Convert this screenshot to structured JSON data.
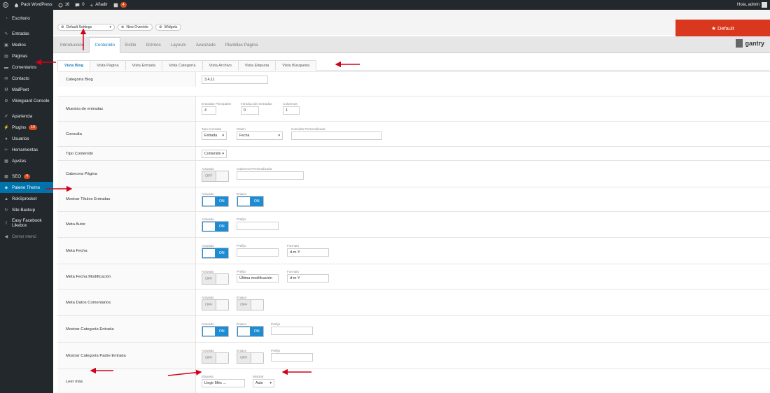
{
  "adminbar": {
    "site": "Pack WordPress",
    "updates": "16",
    "comments": "0",
    "new": "Añadir",
    "wf_badge": "4",
    "greeting": "Hola, admin"
  },
  "sidebar": [
    {
      "icon": "dashboard-icon",
      "label": "Escritorio"
    },
    {
      "icon": "pin-icon",
      "label": "Entradas",
      "sep": true
    },
    {
      "icon": "media-icon",
      "label": "Medios"
    },
    {
      "icon": "pages-icon",
      "label": "Páginas"
    },
    {
      "icon": "comments-icon",
      "label": "Comentarios"
    },
    {
      "icon": "mail-icon",
      "label": "Contacto"
    },
    {
      "icon": "mailpoet-icon",
      "label": "MailPoet"
    },
    {
      "icon": "gear-icon",
      "label": "Vikinguard Console"
    },
    {
      "icon": "brush-icon",
      "label": "Apariencia",
      "sep": true
    },
    {
      "icon": "plug-icon",
      "label": "Plugins",
      "badge": "10"
    },
    {
      "icon": "user-icon",
      "label": "Usuarios"
    },
    {
      "icon": "wrench-icon",
      "label": "Herramientas"
    },
    {
      "icon": "settings-icon",
      "label": "Ajustes"
    },
    {
      "icon": "seo-icon",
      "label": "SEO",
      "badge": "4",
      "sep": true
    },
    {
      "icon": "theme-icon",
      "label": "Palene Theme",
      "current": true
    },
    {
      "icon": "rocket-icon",
      "label": "RokSprocket"
    },
    {
      "icon": "backup-icon",
      "label": "Site Backup"
    },
    {
      "icon": "facebook-icon",
      "label": "Easy Facebook Likebox",
      "tall": true
    },
    {
      "icon": "collapse-icon",
      "label": "Cerrar menú",
      "collapse": true
    }
  ],
  "toolbar": {
    "preset": "Default Settings",
    "new_override": "New Override",
    "widgets": "Widgets",
    "default_btn": "★ Default"
  },
  "tabs": [
    "Introducción",
    "Contenido",
    "Estilo",
    "Gizmos",
    "Layouts",
    "Avanzado",
    "Plantillas Página"
  ],
  "brand": "gantry",
  "subtabs": [
    "Vista Blog",
    "Vista Página",
    "Vista Entrada",
    "Vista Categoría",
    "Vista Archivo",
    "Vista Etiqueta",
    "Vista Búsqueda"
  ],
  "rows": [
    {
      "label": "Categoría Blog",
      "fields": [
        {
          "kind": "input",
          "value": "3,4,11"
        }
      ]
    },
    {
      "label": "Muestra de entradas",
      "fields": [
        {
          "kind": "input",
          "cap": "Entradas Principales",
          "value": "4"
        },
        {
          "kind": "input",
          "cap": "Introducción Entradas",
          "value": "0"
        },
        {
          "kind": "input",
          "cap": "Columnas",
          "value": "1"
        }
      ]
    },
    {
      "label": "Consulta",
      "fields": [
        {
          "kind": "select",
          "cap": "Tipo Consulta",
          "value": "Entrada"
        },
        {
          "kind": "select",
          "cap": "Orden",
          "value": "Fecha"
        },
        {
          "kind": "input",
          "cap": "Consulta Personalizada",
          "value": ""
        }
      ]
    },
    {
      "label": "Tipo Contenido",
      "fields": [
        {
          "kind": "select",
          "value": "Contenido"
        }
      ]
    },
    {
      "label": "Cabecera Página",
      "fields": [
        {
          "kind": "toggle",
          "cap": "Activado",
          "on": false,
          "text": "OFF"
        },
        {
          "kind": "input",
          "cap": "Cabecera Personalizada",
          "value": ""
        }
      ]
    },
    {
      "label": "Mostrar Títulos Entradas",
      "fields": [
        {
          "kind": "toggle",
          "cap": "Activado",
          "on": true,
          "text": "ON"
        },
        {
          "kind": "toggle",
          "cap": "Enlace",
          "on": true,
          "text": "ON"
        }
      ]
    },
    {
      "label": "Meta Autor",
      "fields": [
        {
          "kind": "toggle",
          "cap": "Activado",
          "on": true,
          "text": "ON"
        },
        {
          "kind": "input",
          "cap": "Prefijo",
          "value": ""
        }
      ]
    },
    {
      "label": "Meta Fecha",
      "fields": [
        {
          "kind": "toggle",
          "cap": "Activado",
          "on": true,
          "text": "ON"
        },
        {
          "kind": "input",
          "cap": "Prefijo",
          "value": ""
        },
        {
          "kind": "input",
          "cap": "Formato",
          "value": "d-m-Y"
        }
      ]
    },
    {
      "label": "Meta Fecha Modificación",
      "fields": [
        {
          "kind": "toggle",
          "cap": "Activado",
          "on": false,
          "text": "OFF"
        },
        {
          "kind": "input",
          "cap": "Prefijo",
          "value": "Última modificación"
        },
        {
          "kind": "input",
          "cap": "Formato",
          "value": "d-m-Y"
        }
      ]
    },
    {
      "label": "Meta Datos Comentarios",
      "fields": [
        {
          "kind": "toggle",
          "cap": "Activado",
          "on": false,
          "text": "OFF"
        },
        {
          "kind": "toggle",
          "cap": "Enlace",
          "on": false,
          "text": "OFF"
        }
      ]
    },
    {
      "label": "Mostrar Categoría Entrada",
      "fields": [
        {
          "kind": "toggle",
          "cap": "Activado",
          "on": true,
          "text": "ON"
        },
        {
          "kind": "toggle",
          "cap": "Enlace",
          "on": true,
          "text": "ON"
        },
        {
          "kind": "input",
          "cap": "Prefijo",
          "value": ""
        }
      ]
    },
    {
      "label": "Mostrar Categoría Padre Entrada",
      "fields": [
        {
          "kind": "toggle",
          "cap": "Activado",
          "on": false,
          "text": "OFF"
        },
        {
          "kind": "toggle",
          "cap": "Enlace",
          "on": false,
          "text": "OFF"
        },
        {
          "kind": "input",
          "cap": "Prefijo",
          "value": ""
        }
      ]
    },
    {
      "label": "Leer más",
      "fields": [
        {
          "kind": "input",
          "cap": "Etiqueta",
          "value": "Llegir Més ..."
        },
        {
          "kind": "select",
          "cap": "Mostrar",
          "value": "Auto"
        }
      ]
    }
  ],
  "colors": {
    "accent": "#0073aa",
    "tab_active": "#1a7bb9",
    "toggle_on": "#1e8cd3",
    "default_btn": "#d9381e",
    "annotation": "#d0021b"
  }
}
